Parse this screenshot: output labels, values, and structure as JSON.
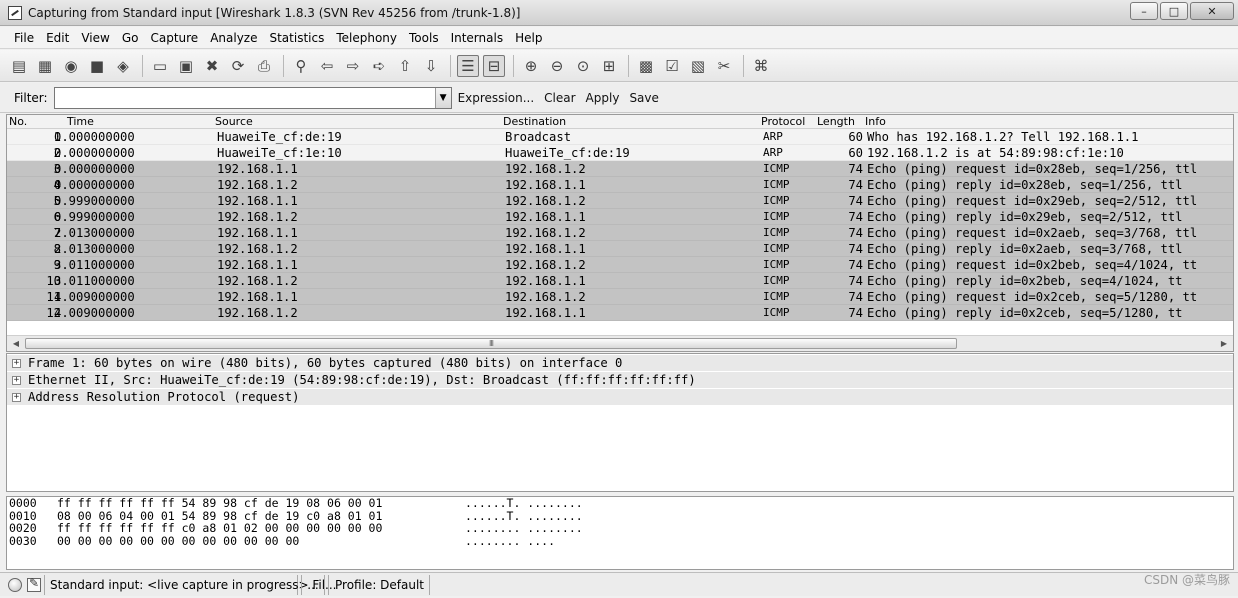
{
  "window": {
    "title": "Capturing from Standard input   [Wireshark 1.8.3  (SVN Rev 45256 from /trunk-1.8)]",
    "buttons": [
      "–",
      "□",
      "✕"
    ]
  },
  "menu": [
    "File",
    "Edit",
    "View",
    "Go",
    "Capture",
    "Analyze",
    "Statistics",
    "Telephony",
    "Tools",
    "Internals",
    "Help"
  ],
  "filter": {
    "label": "Filter:",
    "value": "",
    "buttons": [
      "Expression...",
      "Clear",
      "Apply",
      "Save"
    ]
  },
  "packet_list": {
    "columns": [
      "No.",
      "Time",
      "Source",
      "Destination",
      "Protocol",
      "Length",
      "Info"
    ],
    "rows": [
      {
        "no": "1",
        "time": "0.000000000",
        "src": "HuaweiTe_cf:de:19",
        "dst": "Broadcast",
        "proto": "ARP",
        "len": "60",
        "info": "Who has 192.168.1.2?  Tell 192.168.1.1",
        "shade": "light"
      },
      {
        "no": "2",
        "time": "0.000000000",
        "src": "HuaweiTe_cf:1e:10",
        "dst": "HuaweiTe_cf:de:19",
        "proto": "ARP",
        "len": "60",
        "info": "192.168.1.2 is at 54:89:98:cf:1e:10",
        "shade": "light"
      },
      {
        "no": "3",
        "time": "0.000000000",
        "src": "192.168.1.1",
        "dst": "192.168.1.2",
        "proto": "ICMP",
        "len": "74",
        "info": "Echo (ping) request  id=0x28eb, seq=1/256, ttl",
        "shade": "dark"
      },
      {
        "no": "4",
        "time": "0.000000000",
        "src": "192.168.1.2",
        "dst": "192.168.1.1",
        "proto": "ICMP",
        "len": "74",
        "info": "Echo (ping) reply    id=0x28eb, seq=1/256, ttl",
        "shade": "dark"
      },
      {
        "no": "5",
        "time": "0.999000000",
        "src": "192.168.1.1",
        "dst": "192.168.1.2",
        "proto": "ICMP",
        "len": "74",
        "info": "Echo (ping) request  id=0x29eb, seq=2/512, ttl",
        "shade": "dark"
      },
      {
        "no": "6",
        "time": "0.999000000",
        "src": "192.168.1.2",
        "dst": "192.168.1.1",
        "proto": "ICMP",
        "len": "74",
        "info": "Echo (ping) reply    id=0x29eb, seq=2/512, ttl",
        "shade": "dark"
      },
      {
        "no": "7",
        "time": "2.013000000",
        "src": "192.168.1.1",
        "dst": "192.168.1.2",
        "proto": "ICMP",
        "len": "74",
        "info": "Echo (ping) request  id=0x2aeb, seq=3/768, ttl",
        "shade": "dark"
      },
      {
        "no": "8",
        "time": "2.013000000",
        "src": "192.168.1.2",
        "dst": "192.168.1.1",
        "proto": "ICMP",
        "len": "74",
        "info": "Echo (ping) reply    id=0x2aeb, seq=3/768, ttl",
        "shade": "dark"
      },
      {
        "no": "9",
        "time": "3.011000000",
        "src": "192.168.1.1",
        "dst": "192.168.1.2",
        "proto": "ICMP",
        "len": "74",
        "info": "Echo (ping) request  id=0x2beb, seq=4/1024, tt",
        "shade": "dark"
      },
      {
        "no": "10",
        "time": "3.011000000",
        "src": "192.168.1.2",
        "dst": "192.168.1.1",
        "proto": "ICMP",
        "len": "74",
        "info": "Echo (ping) reply    id=0x2beb, seq=4/1024, tt",
        "shade": "dark"
      },
      {
        "no": "11",
        "time": "4.009000000",
        "src": "192.168.1.1",
        "dst": "192.168.1.2",
        "proto": "ICMP",
        "len": "74",
        "info": "Echo (ping) request  id=0x2ceb, seq=5/1280, tt",
        "shade": "dark"
      },
      {
        "no": "12",
        "time": "4.009000000",
        "src": "192.168.1.2",
        "dst": "192.168.1.1",
        "proto": "ICMP",
        "len": "74",
        "info": "Echo (ping) reply    id=0x2ceb, seq=5/1280, tt",
        "shade": "dark"
      }
    ],
    "scrollbar_grip": "III"
  },
  "details": [
    "Frame 1: 60 bytes on wire (480 bits), 60 bytes captured (480 bits) on interface 0",
    "Ethernet II, Src: HuaweiTe_cf:de:19 (54:89:98:cf:de:19), Dst: Broadcast (ff:ff:ff:ff:ff:ff)",
    "Address Resolution Protocol (request)"
  ],
  "bytes": [
    {
      "offset": "0000",
      "hex": "ff ff ff ff ff ff 54 89  98 cf de 19 08 06 00 01",
      "ascii": "......T. ........"
    },
    {
      "offset": "0010",
      "hex": "08 00 06 04 00 01 54 89  98 cf de 19 c0 a8 01 01",
      "ascii": "......T. ........"
    },
    {
      "offset": "0020",
      "hex": "ff ff ff ff ff ff c0 a8  01 02 00 00 00 00 00 00",
      "ascii": "........ ........"
    },
    {
      "offset": "0030",
      "hex": "00 00 00 00 00 00 00 00  00 00 00 00",
      "ascii": "........ ...."
    }
  ],
  "status": {
    "main": "Standard input: <live capture in progress> Fil...",
    "dots": "...",
    "profile": "Profile: Default"
  },
  "watermark": "CSDN @菜鸟豚",
  "toolbar_icons": [
    "interfaces-icon",
    "options-icon",
    "start-icon",
    "stop-icon",
    "restart-icon",
    "open-icon",
    "save-icon",
    "close-icon",
    "reload-icon",
    "print-icon",
    "find-icon",
    "back-icon",
    "forward-icon",
    "goto-icon",
    "first-icon",
    "last-icon",
    "colorize-icon",
    "autoscroll-icon",
    "zoom-in-icon",
    "zoom-out-icon",
    "normal-size-icon",
    "resize-columns-icon",
    "capture-filters-icon",
    "display-filters-icon",
    "coloring-rules-icon",
    "preferences-icon",
    "help-icon"
  ]
}
